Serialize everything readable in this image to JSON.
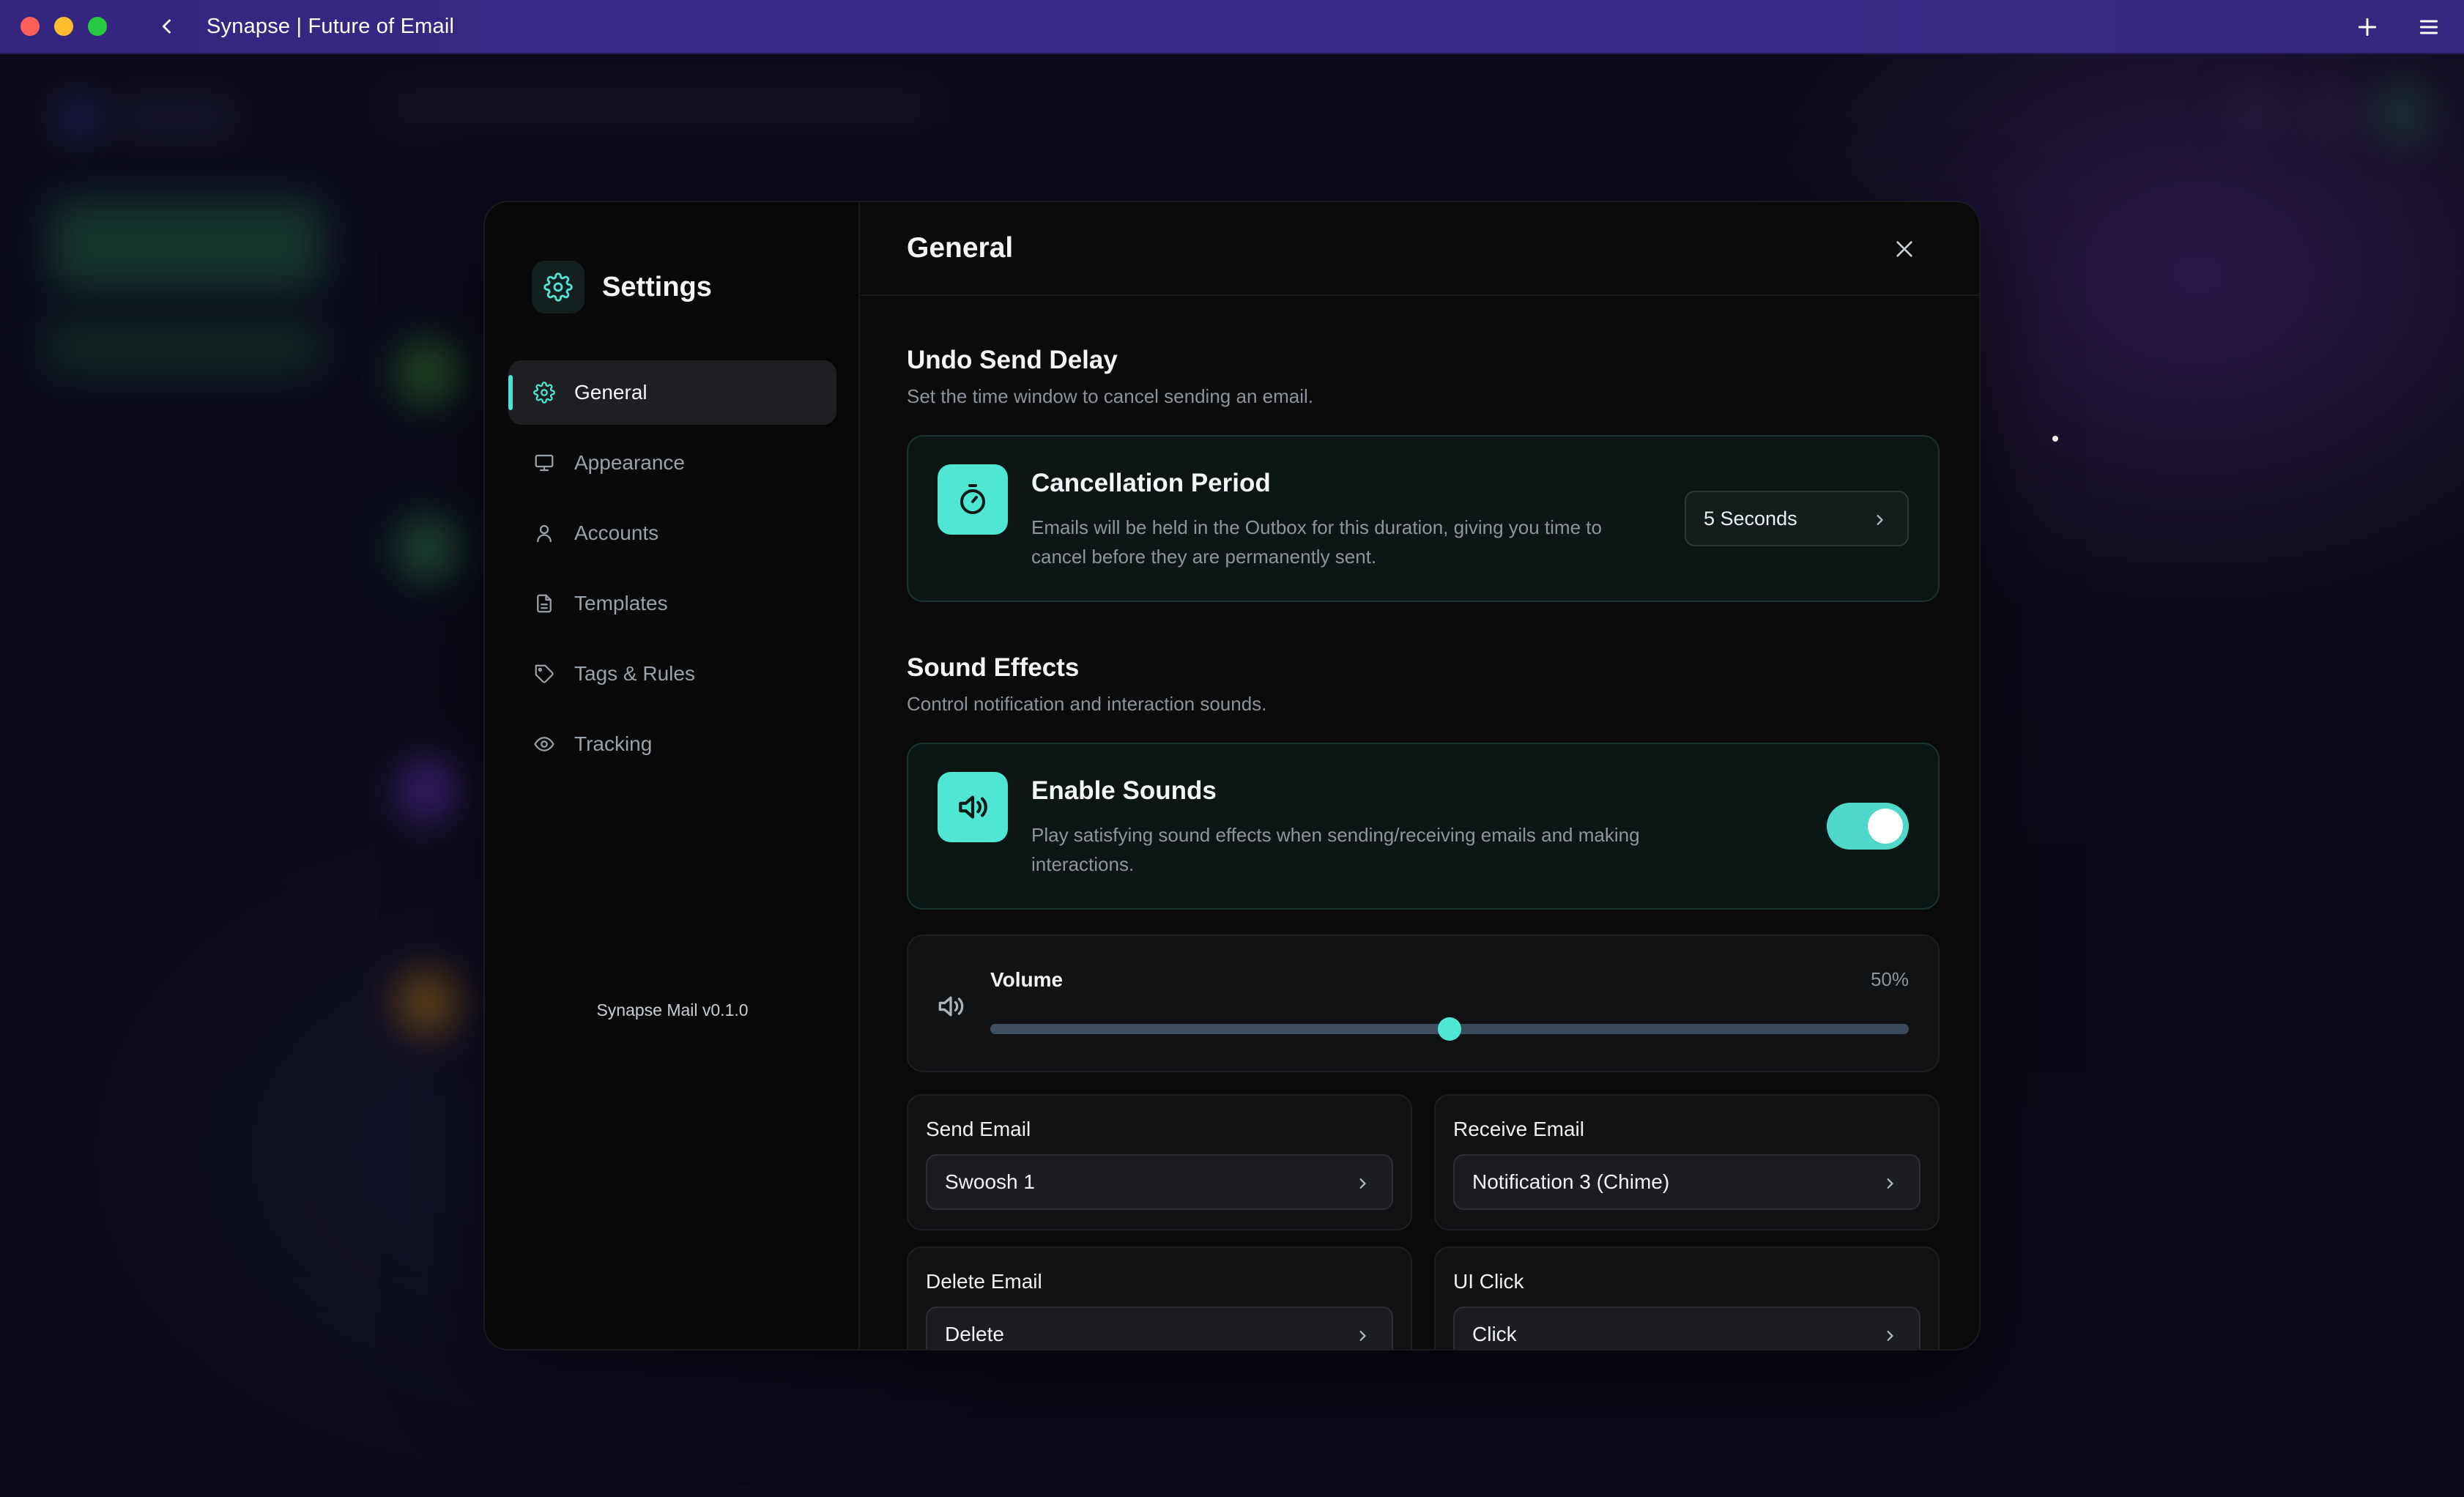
{
  "window": {
    "title": "Synapse | Future of Email"
  },
  "sidebar": {
    "title": "Settings",
    "items": [
      {
        "label": "General",
        "icon": "gear-icon",
        "active": true
      },
      {
        "label": "Appearance",
        "icon": "monitor-icon",
        "active": false
      },
      {
        "label": "Accounts",
        "icon": "user-icon",
        "active": false
      },
      {
        "label": "Templates",
        "icon": "document-icon",
        "active": false
      },
      {
        "label": "Tags & Rules",
        "icon": "tag-icon",
        "active": false
      },
      {
        "label": "Tracking",
        "icon": "eye-icon",
        "active": false
      }
    ],
    "version": "Synapse Mail v0.1.0"
  },
  "main": {
    "header": "General",
    "undo": {
      "title": "Undo Send Delay",
      "subtitle": "Set the time window to cancel sending an email.",
      "card_title": "Cancellation Period",
      "card_desc": "Emails will be held in the Outbox for this duration, giving you time to cancel before they are permanently sent.",
      "value": "5 Seconds"
    },
    "sound": {
      "title": "Sound Effects",
      "subtitle": "Control notification and interaction sounds.",
      "card_title": "Enable Sounds",
      "card_desc": "Play satisfying sound effects when sending/receiving emails and making interactions.",
      "enabled": true
    },
    "volume": {
      "label": "Volume",
      "value_text": "50%",
      "value": 0.5
    },
    "sounds": {
      "send": {
        "label": "Send Email",
        "value": "Swoosh 1"
      },
      "receive": {
        "label": "Receive Email",
        "value": "Notification 3 (Chime)"
      },
      "delete": {
        "label": "Delete Email",
        "value": "Delete"
      },
      "click": {
        "label": "UI Click",
        "value": "Click"
      }
    }
  },
  "colors": {
    "accent": "#4fe6d4",
    "titlebar": "#35287f"
  }
}
